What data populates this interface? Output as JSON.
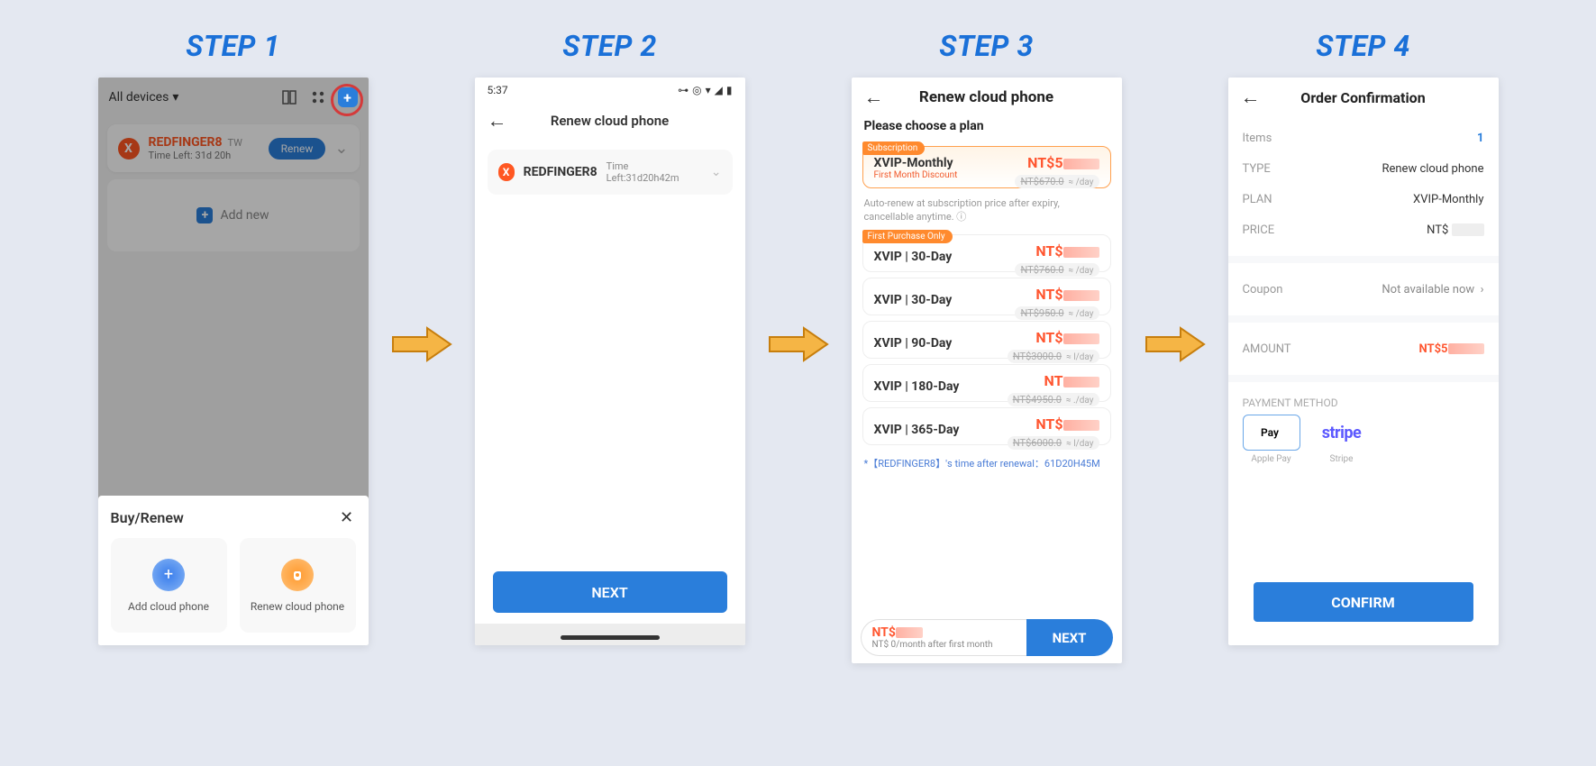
{
  "steps": {
    "s1": "STEP 1",
    "s2": "STEP 2",
    "s3": "STEP 3",
    "s4": "STEP 4"
  },
  "step1": {
    "topbar_left": "All devices",
    "device_name": "REDFINGER8",
    "device_region": "TW",
    "time_left": "Time Left: 31d 20h",
    "renew_btn": "Renew",
    "add_new": "Add new",
    "sheet_title": "Buy/Renew",
    "opt_add": "Add cloud phone",
    "opt_renew": "Renew cloud phone"
  },
  "step2": {
    "statusbar_time": "5:37",
    "header": "Renew cloud phone",
    "device_name": "REDFINGER8",
    "time_left": "Time Left:31d20h42m",
    "next_btn": "NEXT"
  },
  "step3": {
    "header": "Renew cloud phone",
    "choose_plan": "Please choose a plan",
    "plan_sub": {
      "tag": "Subscription",
      "title": "XVIP-Monthly",
      "disc": "First Month Discount",
      "price": "NT$5",
      "strike": "NT$670.0",
      "per": "≈        /day"
    },
    "auto_note": "Auto-renew at subscription price after expiry, cancellable anytime. ⓘ",
    "plans": [
      {
        "tag": "First Purchase Only",
        "title": "XVIP | 30-Day",
        "price": "NT$",
        "strike": "NT$760.0",
        "per": "≈    /day"
      },
      {
        "title": "XVIP | 30-Day",
        "price": "NT$",
        "strike": "NT$950.0",
        "per": "≈    /day"
      },
      {
        "title": "XVIP | 90-Day",
        "price": "NT$",
        "strike": "NT$3000.0",
        "per": "≈    l/day"
      },
      {
        "title": "XVIP | 180-Day",
        "price": "NT",
        "strike": "NT$4950.0",
        "per": "≈    ./day"
      },
      {
        "title": "XVIP | 365-Day",
        "price": "NT$",
        "strike": "NT$6000.0",
        "per": "≈    l/day"
      }
    ],
    "renewal_note": "*【REDFINGER8】's time after renewal：61D20H45M",
    "footer_price": "NT$",
    "footer_note": "NT$    0/month after first month",
    "footer_next": "NEXT"
  },
  "step4": {
    "header": "Order Confirmation",
    "items_label": "Items",
    "items_val": "1",
    "type_label": "TYPE",
    "type_val": "Renew cloud phone",
    "plan_label": "PLAN",
    "plan_val": "XVIP-Monthly",
    "price_label": "PRICE",
    "price_val": "NT$",
    "coupon_label": "Coupon",
    "coupon_val": "Not available now",
    "amount_label": "AMOUNT",
    "amount_val": "NT$5",
    "pay_label": "PAYMENT METHOD",
    "pm_apple": " Pay",
    "pm_apple_cap": "Apple Pay",
    "pm_stripe": "stripe",
    "pm_stripe_cap": "Stripe",
    "confirm_btn": "CONFIRM"
  }
}
